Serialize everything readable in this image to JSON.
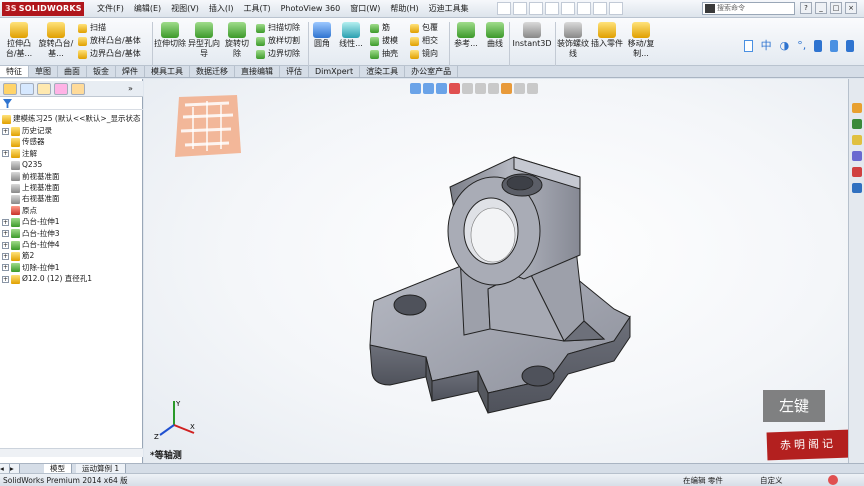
{
  "app": {
    "logo": "SOLIDWORKS",
    "logo_prefix": "3S"
  },
  "menu": [
    "文件(F)",
    "编辑(E)",
    "视图(V)",
    "插入(I)",
    "工具(T)",
    "PhotoView 360",
    "窗口(W)",
    "帮助(H)",
    "迈迪工具集"
  ],
  "search": {
    "placeholder": "搜索命令"
  },
  "ribbon": {
    "extrude_boss": "拉伸凸台/基...",
    "revolve_boss": "旋转凸台/基...",
    "sweep": "扫描",
    "loft_boss": "放样凸台/基体",
    "boundary_boss": "边界凸台/基体",
    "extrude_cut": "拉伸切除",
    "hole_wizard": "异型孔向导",
    "revolve_cut": "旋转切除",
    "sweep_cut": "扫描切除",
    "loft_cut": "放样切割",
    "boundary_cut": "边界切除",
    "fillet": "圆角",
    "linear_pattern": "线性...",
    "rib": "筋",
    "draft": "拔模",
    "shell": "抽壳",
    "wrap": "包覆",
    "intersect": "相交",
    "mirror": "镜向",
    "reference": "参考...",
    "curves": "曲线",
    "instant3d": "Instant3D",
    "cosmetic_thread": "装饰螺纹线",
    "insert_part": "插入零件",
    "move_copy": "移动/复制..."
  },
  "tabs": [
    "特征",
    "草图",
    "曲面",
    "钣金",
    "焊件",
    "模具工具",
    "数据迁移",
    "直接编辑",
    "评估",
    "DimXpert",
    "渲染工具",
    "办公室产品"
  ],
  "tree": {
    "root": "建模练习25 (默认<<默认>_显示状态",
    "items": [
      {
        "label": "历史记录",
        "exp": "+"
      },
      {
        "label": "传感器",
        "exp": ""
      },
      {
        "label": "注解",
        "exp": "+"
      },
      {
        "label": "Q235",
        "exp": ""
      },
      {
        "label": "前视基准面",
        "exp": ""
      },
      {
        "label": "上视基准面",
        "exp": ""
      },
      {
        "label": "右视基准面",
        "exp": ""
      },
      {
        "label": "原点",
        "exp": ""
      },
      {
        "label": "凸台-拉伸1",
        "exp": "+"
      },
      {
        "label": "凸台-拉伸3",
        "exp": "+"
      },
      {
        "label": "凸台-拉伸4",
        "exp": "+"
      },
      {
        "label": "筋2",
        "exp": "+"
      },
      {
        "label": "切除-拉伸1",
        "exp": "+"
      },
      {
        "label": "Ø12.0 (12) 直径孔1",
        "exp": "+"
      }
    ]
  },
  "viewport": {
    "view_name": "*等轴测",
    "mouse_hint": "左键",
    "stamp": "赤明阁记",
    "triad": {
      "x": "X",
      "y": "Y",
      "z": "Z"
    }
  },
  "bottom_tabs": [
    "模型",
    "运动算例 1"
  ],
  "status": {
    "product": "SolidWorks Premium 2014 x64 版",
    "mode": "在编辑 零件",
    "custom": "自定义"
  }
}
